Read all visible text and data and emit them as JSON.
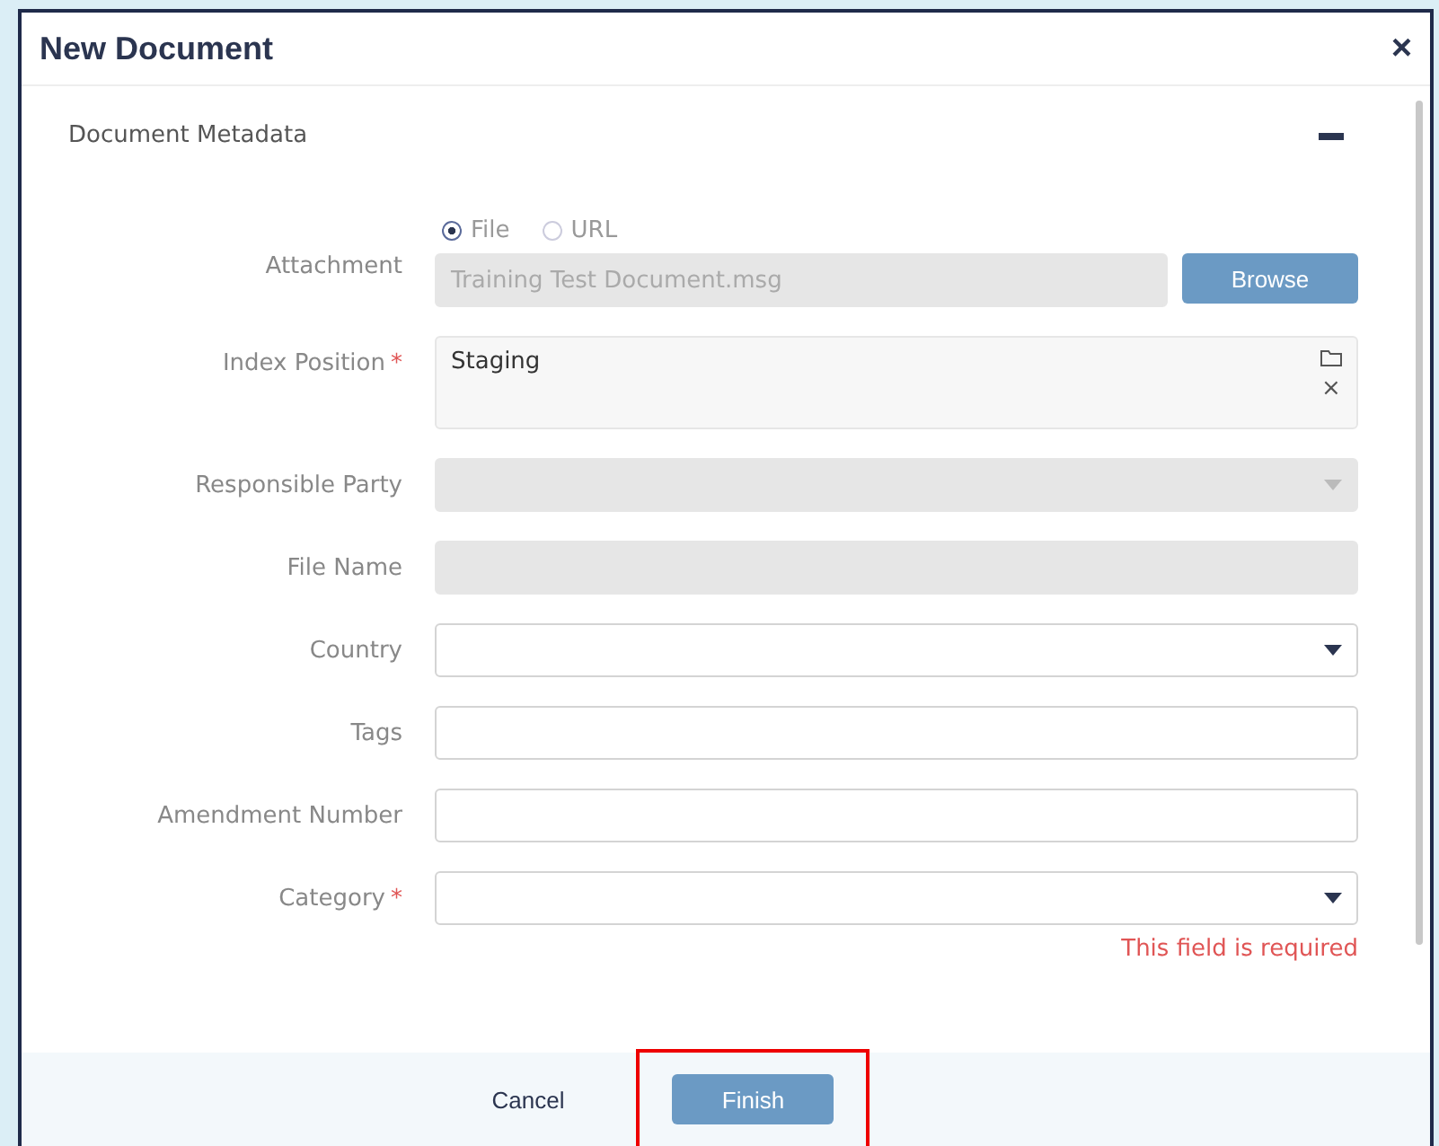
{
  "dialog": {
    "title": "New Document",
    "close_icon": "×"
  },
  "section": {
    "title": "Document Metadata",
    "expanded": true
  },
  "fields": [
    {
      "kind": "attachment",
      "label": "Attachment",
      "options": [
        {
          "label": "File",
          "selected": true
        },
        {
          "label": "URL",
          "selected": false
        }
      ],
      "value": "Training Test Document.msg",
      "button": "Browse"
    },
    {
      "kind": "multi",
      "label": "Index Position",
      "required_mark": "*",
      "value": "Staging",
      "clear": "×"
    },
    {
      "kind": "select",
      "label": "Responsible Party",
      "disabled": true
    },
    {
      "kind": "text",
      "label": "File Name",
      "disabled": true
    },
    {
      "kind": "select",
      "label": "Country",
      "disabled": false
    },
    {
      "kind": "text",
      "label": "Tags",
      "disabled": false
    },
    {
      "kind": "text",
      "label": "Amendment Number",
      "disabled": false
    },
    {
      "kind": "select",
      "label": "Category",
      "required_mark": "*",
      "disabled": false,
      "error": "This field is required"
    }
  ],
  "buttons": [
    {
      "label": "Cancel",
      "kind": "secondary"
    },
    {
      "label": "Finish",
      "kind": "primary",
      "highlighted": true
    }
  ]
}
